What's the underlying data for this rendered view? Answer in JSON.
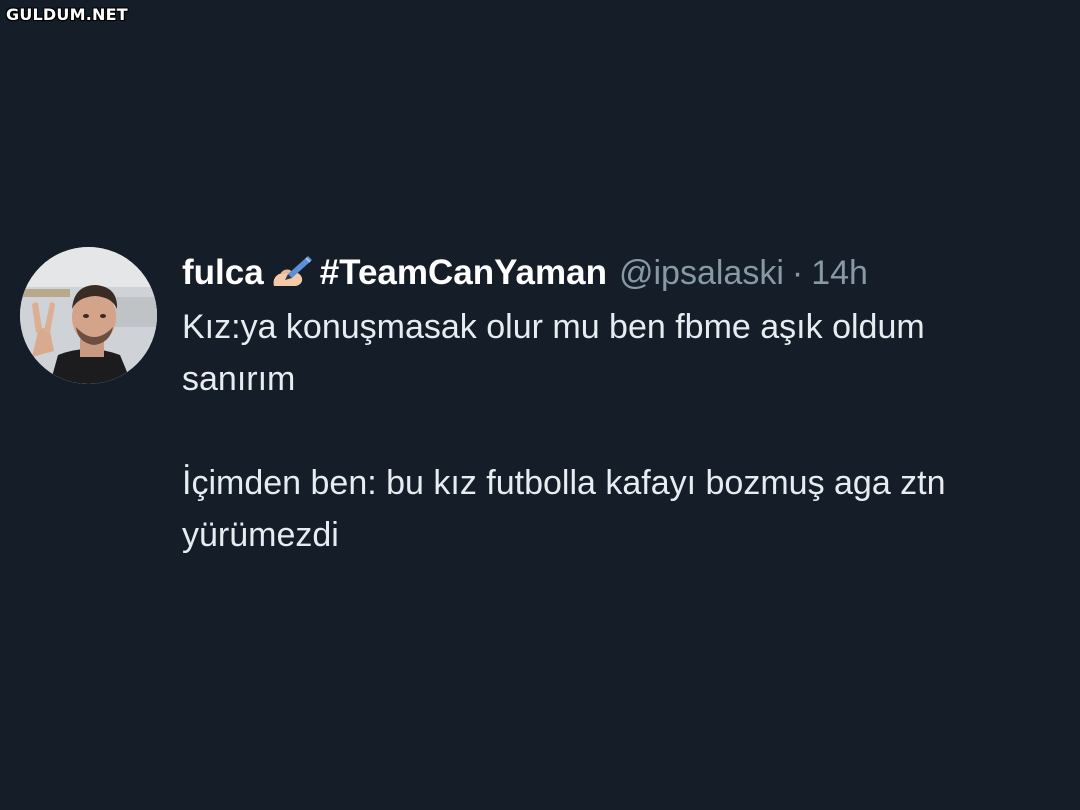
{
  "watermark": "GULDUM.NET",
  "tweet": {
    "display_name": "fulca",
    "name_icon": "writing-hand-icon",
    "hashtag": "#TeamCanYaman",
    "handle": "@ipsalaski",
    "separator": "·",
    "time": "14h",
    "lines": [
      "Kız:ya konuşmasak olur mu ben fbme aşık oldum",
      "sanırım",
      "İçimden ben: bu kız futbolla kafayı bozmuş aga ztn",
      "yürümezdi"
    ]
  },
  "colors": {
    "background": "#151d28",
    "text": "#e7ecf0",
    "secondary": "#8899a6"
  }
}
